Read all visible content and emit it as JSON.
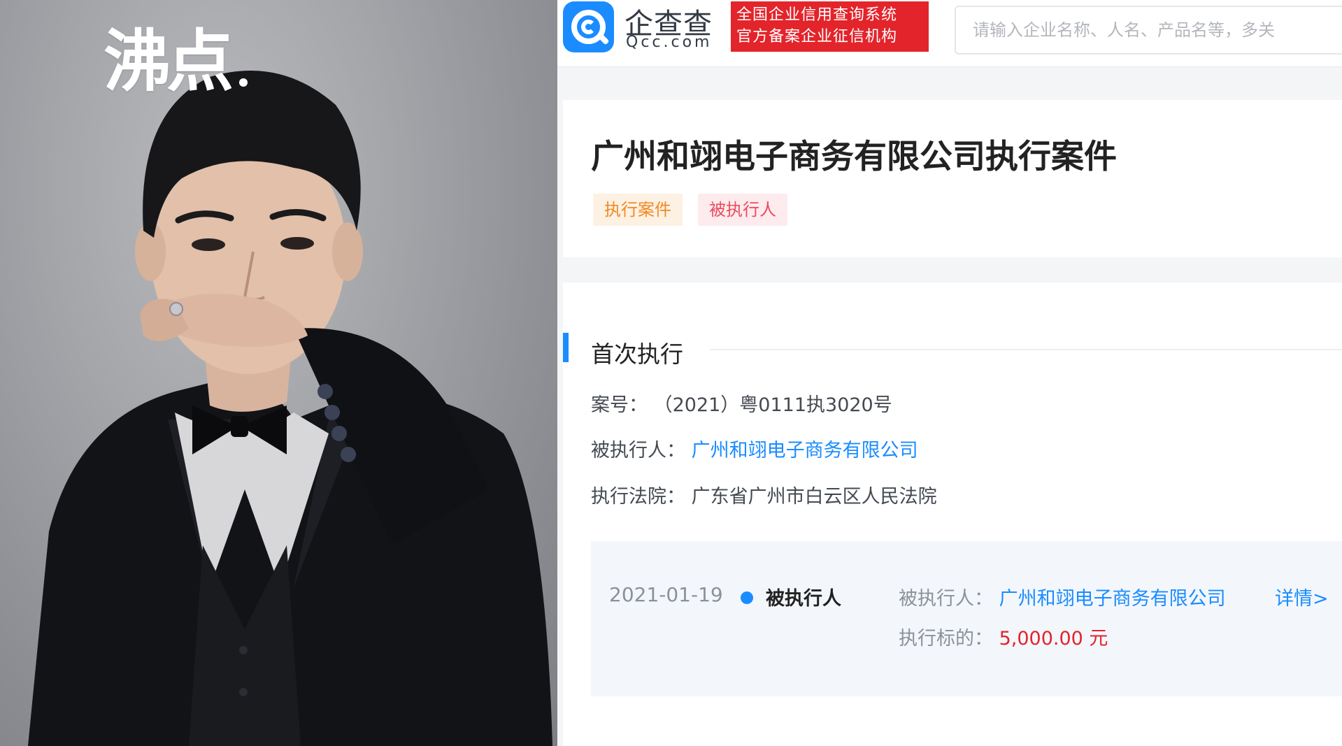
{
  "watermark": {
    "text": "沸点"
  },
  "site": {
    "brand_cn": "企查查",
    "brand_en": "Qcc.com",
    "badge_line1": "全国企业信用查询系统",
    "badge_line2": "官方备案企业征信机构",
    "search_placeholder": "请输入企业名称、人名、产品名等，多关",
    "accent_color": "#1a8cff",
    "badge_color": "#e3242b"
  },
  "case": {
    "title": "广州和翊电子商务有限公司执行案件",
    "tags": [
      "执行案件",
      "被执行人"
    ]
  },
  "section": {
    "title": "首次执行",
    "case_no_label": "案号：",
    "case_no": "（2021）粤0111执3020号",
    "party_label": "被执行人：",
    "party": "广州和翊电子商务有限公司",
    "court_label": "执行法院：",
    "court": "广东省广州市白云区人民法院"
  },
  "timeline": {
    "date": "2021-01-19",
    "role": "被执行人",
    "party_label": "被执行人：",
    "party": "广州和翊电子商务有限公司",
    "detail_link": "详情>",
    "amount_label": "执行标的：",
    "amount": "5,000.00 元"
  }
}
